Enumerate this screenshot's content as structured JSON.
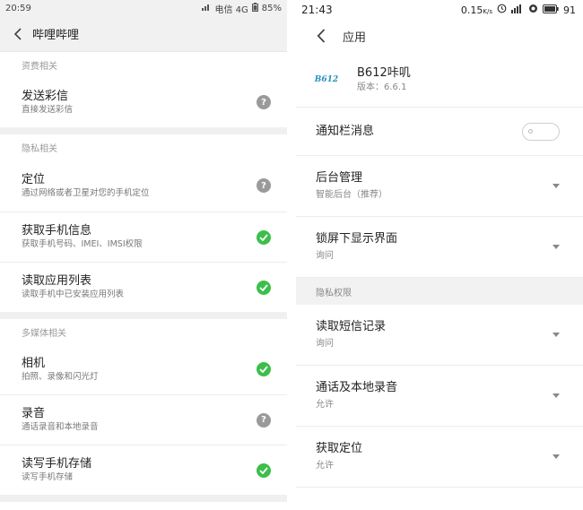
{
  "left": {
    "statusbar": {
      "time": "20:59",
      "carrier": "电信 4G",
      "battery": "85%"
    },
    "appbar": {
      "title": "哔哩哔哩"
    },
    "sections": [
      {
        "header": "资费相关",
        "items": [
          {
            "label": "发送彩信",
            "sub": "直接发送彩信",
            "status": "ask"
          }
        ]
      },
      {
        "header": "隐私相关",
        "items": [
          {
            "label": "定位",
            "sub": "通过网络或者卫星对您的手机定位",
            "status": "ask"
          },
          {
            "label": "获取手机信息",
            "sub": "获取手机号码、IMEI、IMSI权限",
            "status": "allowed"
          },
          {
            "label": "读取应用列表",
            "sub": "读取手机中已安装应用列表",
            "status": "allowed"
          }
        ]
      },
      {
        "header": "多媒体相关",
        "items": [
          {
            "label": "相机",
            "sub": "拍照、录像和闪光灯",
            "status": "allowed"
          },
          {
            "label": "录音",
            "sub": "通话录音和本地录音",
            "status": "ask"
          },
          {
            "label": "读写手机存储",
            "sub": "读写手机存储",
            "status": "allowed"
          }
        ]
      }
    ],
    "status_icon_text": "?"
  },
  "right": {
    "statusbar": {
      "time": "21:43",
      "speed": "0.15",
      "speed_unit": "K/s",
      "battery": "91"
    },
    "appbar": {
      "title": "应用"
    },
    "app": {
      "name": "B612咔叽",
      "version": "版本：6.6.1",
      "icon_text": "B612"
    },
    "rows": [
      {
        "label": "通知栏消息",
        "sub": "",
        "control": "toggle",
        "toggle_on": false
      },
      {
        "label": "后台管理",
        "sub": "智能后台（推荐）",
        "control": "dropdown"
      },
      {
        "label": "锁屏下显示界面",
        "sub": "询问",
        "control": "dropdown"
      }
    ],
    "privacy_header": "隐私权限",
    "privacy_rows": [
      {
        "label": "读取短信记录",
        "sub": "询问",
        "control": "dropdown"
      },
      {
        "label": "通话及本地录音",
        "sub": "允许",
        "control": "dropdown"
      },
      {
        "label": "获取定位",
        "sub": "允许",
        "control": "dropdown"
      }
    ]
  },
  "colors": {
    "allowed": "#3cbf4a",
    "ask": "#9a9a9a",
    "band": "#f0f0f0"
  },
  "icons": {
    "back": "chevron-left-icon",
    "allowed": "check-circle-icon",
    "ask": "question-circle-icon",
    "dropdown": "caret-down-icon"
  }
}
